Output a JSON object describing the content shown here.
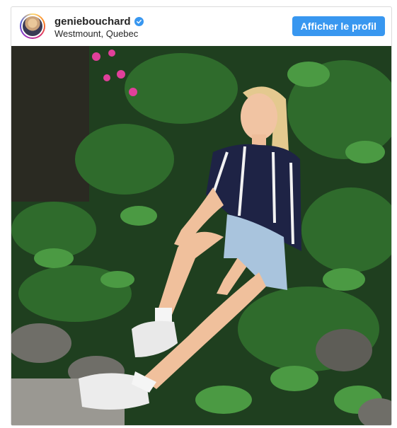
{
  "post": {
    "username": "geniebouchard",
    "location": "Westmount, Quebec",
    "profile_button_label": "Afficher le profil",
    "verified_icon": "verified-badge-icon",
    "accent_color": "#3897f0"
  }
}
